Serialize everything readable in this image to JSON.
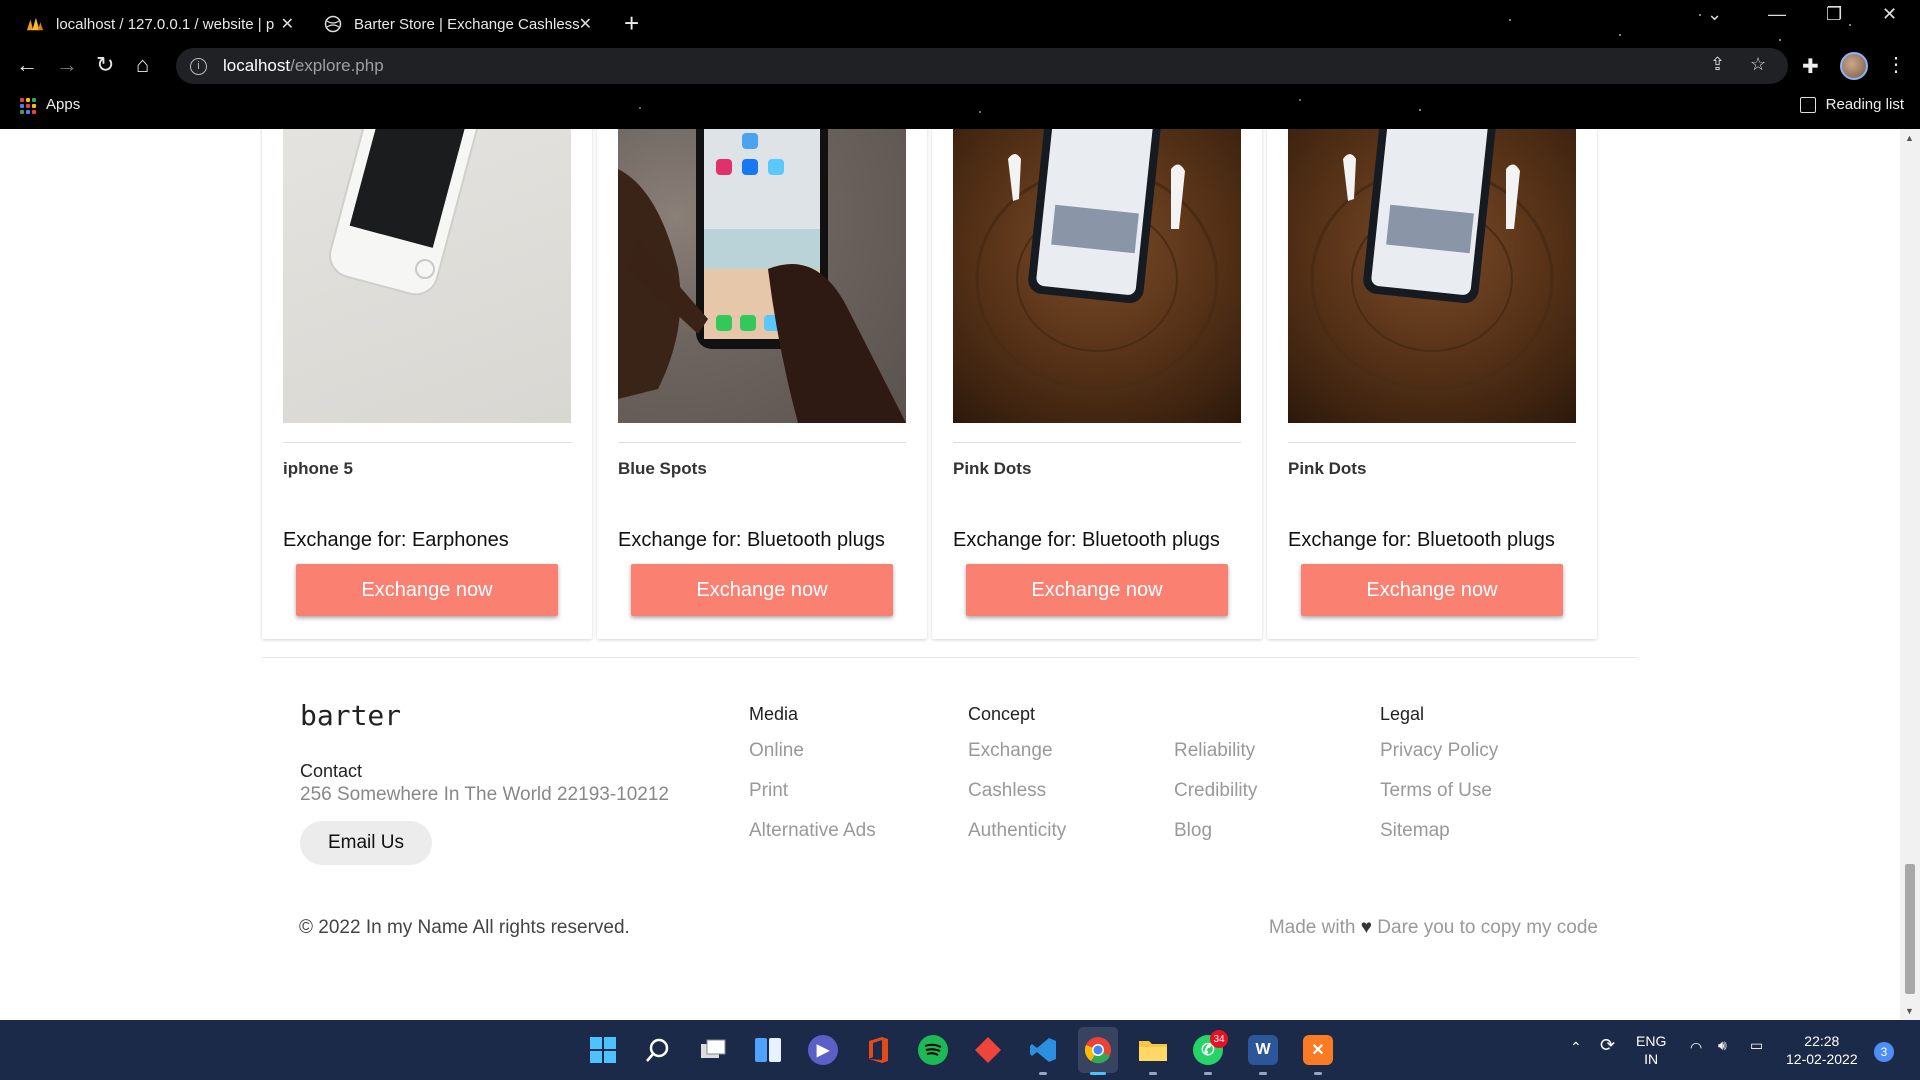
{
  "browser": {
    "tabs": [
      {
        "title": "localhost / 127.0.0.1 / website | p",
        "icon": "phpmyadmin-icon",
        "active": false
      },
      {
        "title": "Barter Store | Exchange Cashless",
        "icon": "globe-icon",
        "active": true
      }
    ],
    "url_host": "localhost",
    "url_path": "/explore.php",
    "bookmarks_apps": "Apps",
    "reading_list": "Reading list"
  },
  "products": [
    {
      "name": "iphone 5",
      "exchange_for": "Exchange for: Earphones",
      "button": "Exchange now"
    },
    {
      "name": "Blue Spots",
      "exchange_for": "Exchange for: Bluetooth plugs",
      "button": "Exchange now"
    },
    {
      "name": "Pink Dots",
      "exchange_for": "Exchange for: Bluetooth plugs",
      "button": "Exchange now"
    },
    {
      "name": "Pink Dots",
      "exchange_for": "Exchange for: Bluetooth plugs",
      "button": "Exchange now"
    }
  ],
  "footer": {
    "brand": "barter",
    "contact_label": "Contact",
    "contact_address": "256 Somewhere In The World 22193-10212",
    "email_button": "Email Us",
    "media": {
      "heading": "Media",
      "links": [
        "Online",
        "Print",
        "Alternative Ads"
      ]
    },
    "concept": {
      "heading": "Concept",
      "links": [
        "Exchange",
        "Cashless",
        "Authenticity"
      ]
    },
    "concept2": {
      "links": [
        "Reliability",
        "Credibility",
        "Blog"
      ]
    },
    "legal": {
      "heading": "Legal",
      "links": [
        "Privacy Policy",
        "Terms of Use",
        "Sitemap"
      ]
    },
    "copyright": "© 2022 In my Name All rights reserved.",
    "made_with_prefix": "Made with",
    "heart": "♥",
    "made_with_suffix": "Dare you to copy my code"
  },
  "taskbar": {
    "lang_top": "ENG",
    "lang_bottom": "IN",
    "time": "22:28",
    "date": "12-02-2022",
    "whatsapp_badge": "34",
    "notification_count": "3"
  },
  "colors": {
    "accent_button": "#fa8072",
    "taskbar": "#1c2a4a"
  }
}
